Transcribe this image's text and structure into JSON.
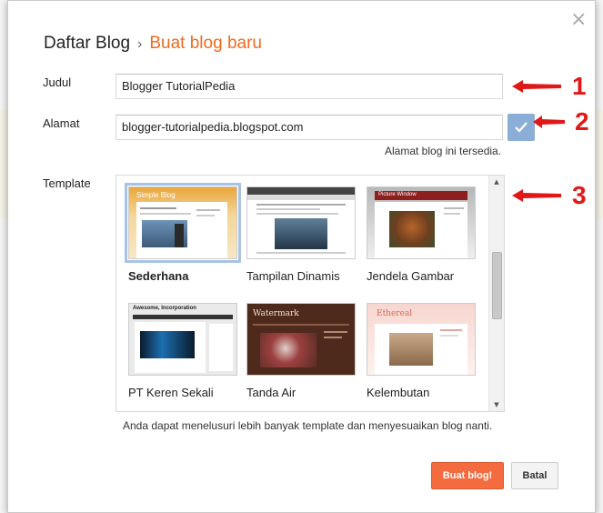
{
  "breadcrumb": {
    "root": "Daftar Blog",
    "separator": "›",
    "current": "Buat blog baru"
  },
  "form": {
    "title_label": "Judul",
    "title_value": "Blogger TutorialPedia",
    "address_label": "Alamat",
    "address_value": "blogger-tutorialpedia.blogspot.com",
    "address_status": "Alamat blog ini tersedia.",
    "template_label": "Template"
  },
  "templates": [
    {
      "name": "Sederhana",
      "preview_title": "Simple Blog",
      "selected": true
    },
    {
      "name": "Tampilan Dinamis",
      "preview_title": "",
      "selected": false
    },
    {
      "name": "Jendela Gambar",
      "preview_title": "Picture Window",
      "selected": false
    },
    {
      "name": "PT Keren Sekali",
      "preview_title": "Awesome, Incorporation",
      "selected": false
    },
    {
      "name": "Tanda Air",
      "preview_title": "Watermark",
      "selected": false
    },
    {
      "name": "Kelembutan",
      "preview_title": "Ethereal",
      "selected": false
    }
  ],
  "template_note": "Anda dapat menelusuri lebih banyak template dan menyesuaikan blog nanti.",
  "buttons": {
    "create": "Buat blog!",
    "cancel": "Batal"
  },
  "callouts": [
    "1",
    "2",
    "3"
  ],
  "colors": {
    "accent_orange": "#f06a1d",
    "primary_button": "#f36b3f",
    "check_button": "#8aaed6",
    "callout_red": "#e01818"
  }
}
